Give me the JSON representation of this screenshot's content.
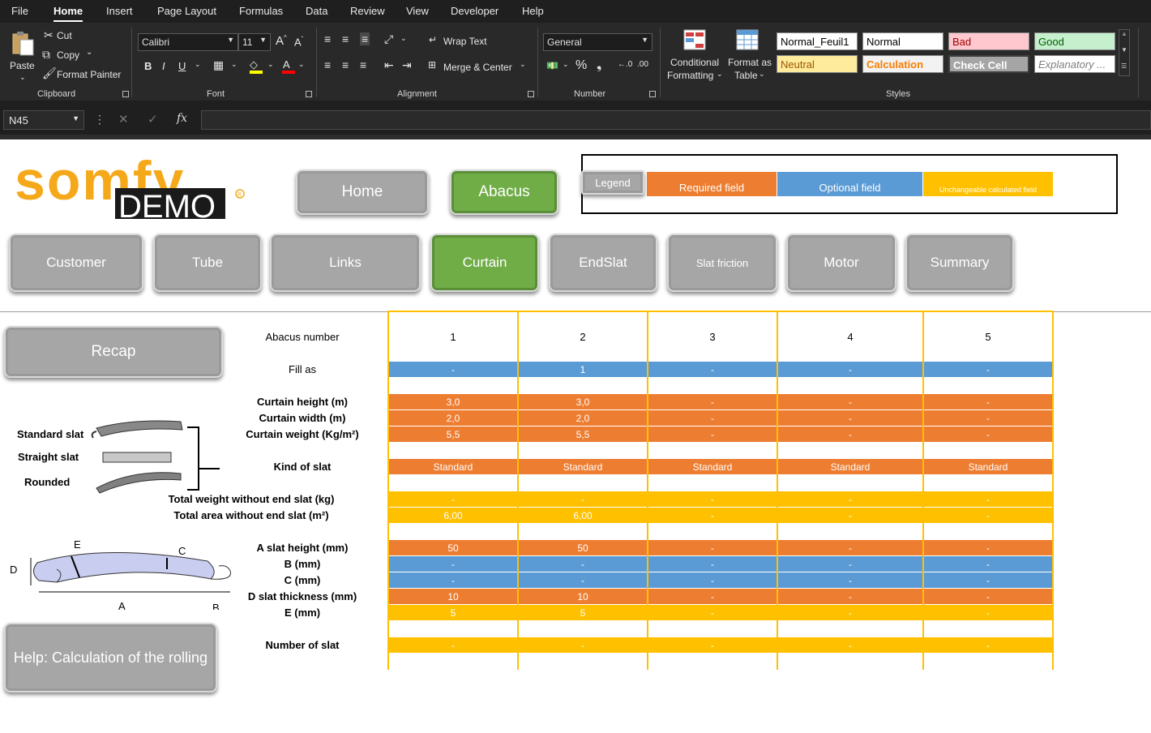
{
  "menu": [
    "File",
    "Home",
    "Insert",
    "Page Layout",
    "Formulas",
    "Data",
    "Review",
    "View",
    "Developer",
    "Help"
  ],
  "clipboard": {
    "paste": "Paste",
    "cut": "Cut",
    "copy": "Copy",
    "format_painter": "Format Painter",
    "group": "Clipboard"
  },
  "font": {
    "name": "Calibri",
    "size": "11",
    "group": "Font",
    "bold": "B",
    "italic": "I",
    "underline": "U"
  },
  "alignment": {
    "wrap_text": "Wrap Text",
    "merge_center": "Merge & Center",
    "group": "Alignment"
  },
  "number": {
    "format": "General",
    "group": "Number"
  },
  "styles": {
    "conditional_formatting": [
      "Conditional",
      "Formatting"
    ],
    "format_as_table": [
      "Format as",
      "Table"
    ],
    "group": "Styles",
    "cells": [
      {
        "label": "Normal_Feuil1",
        "bg": "#ffffff",
        "fg": "#000000"
      },
      {
        "label": "Normal",
        "bg": "#ffffff",
        "fg": "#000000"
      },
      {
        "label": "Bad",
        "bg": "#ffc7ce",
        "fg": "#9c0006"
      },
      {
        "label": "Good",
        "bg": "#c6efce",
        "fg": "#006100"
      },
      {
        "label": "Neutral",
        "bg": "#ffeb9c",
        "fg": "#9c5700"
      },
      {
        "label": "Calculation",
        "bg": "#f2f2f2",
        "fg": "#fa7d00"
      },
      {
        "label": "Check Cell",
        "bg": "#a5a5a5",
        "fg": "#ffffff"
      },
      {
        "label": "Explanatory ...",
        "bg": "#ffffff",
        "fg": "#7f7f7f"
      }
    ]
  },
  "formula_bar": {
    "name_box": "N45",
    "formula": ""
  },
  "logo": {
    "brand": "somfy",
    "sub": "DEMO"
  },
  "nav": {
    "home": "Home",
    "abacus": "Abacus"
  },
  "legend": {
    "title": "Legend",
    "required": "Required field",
    "optional": "Optional field",
    "calculated": "Unchangeable calculated field",
    "colors": {
      "required": "#ed7d31",
      "optional": "#5b9bd5",
      "calculated": "#ffc000"
    }
  },
  "tabs": [
    "Customer",
    "Tube",
    "Links",
    "Curtain",
    "EndSlat",
    "Slat friction",
    "Motor",
    "Summary"
  ],
  "active_tab": "Curtain",
  "side": {
    "recap": "Recap",
    "help": "Help: Calculation of the rolling",
    "slat_types": [
      "Standard slat",
      "Straight slat",
      "Rounded"
    ],
    "diagram_labels": {
      "A": "A",
      "B": "B",
      "C": "C",
      "D": "D",
      "E": "E"
    }
  },
  "table": {
    "row_labels": {
      "abacus_number": "Abacus number",
      "fill_as": "Fill as",
      "curtain_height": "Curtain height (m)",
      "curtain_width": "Curtain width (m)",
      "curtain_weight": "Curtain weight (Kg/m²)",
      "kind_of_slat": "Kind of slat",
      "total_weight": "Total weight without end slat (kg)",
      "total_area": "Total area without end slat (m²)",
      "a_slat_height": "A slat height (mm)",
      "b": "B (mm)",
      "c": "C (mm)",
      "d_slat_thickness": "D slat thickness (mm)",
      "e": "E (mm)",
      "number_of_slat": "Number of slat"
    },
    "columns": [
      {
        "abacus_number": "1",
        "fill_as": "-",
        "curtain_height": "3,0",
        "curtain_width": "2,0",
        "curtain_weight": "5,5",
        "kind_of_slat": "Standard",
        "total_weight": "-",
        "total_area": "6,00",
        "a_slat_height": "50",
        "b": "-",
        "c": "-",
        "d_slat_thickness": "10",
        "e": "5",
        "number_of_slat": "-"
      },
      {
        "abacus_number": "2",
        "fill_as": "1",
        "curtain_height": "3,0",
        "curtain_width": "2,0",
        "curtain_weight": "5,5",
        "kind_of_slat": "Standard",
        "total_weight": "-",
        "total_area": "6,00",
        "a_slat_height": "50",
        "b": "-",
        "c": "-",
        "d_slat_thickness": "10",
        "e": "5",
        "number_of_slat": "-"
      },
      {
        "abacus_number": "3",
        "fill_as": "-",
        "curtain_height": "-",
        "curtain_width": "-",
        "curtain_weight": "-",
        "kind_of_slat": "Standard",
        "total_weight": "-",
        "total_area": "-",
        "a_slat_height": "-",
        "b": "-",
        "c": "-",
        "d_slat_thickness": "-",
        "e": "-",
        "number_of_slat": "-"
      },
      {
        "abacus_number": "4",
        "fill_as": "-",
        "curtain_height": "-",
        "curtain_width": "-",
        "curtain_weight": "-",
        "kind_of_slat": "Standard",
        "total_weight": "-",
        "total_area": "-",
        "a_slat_height": "-",
        "b": "-",
        "c": "-",
        "d_slat_thickness": "-",
        "e": "-",
        "number_of_slat": "-"
      },
      {
        "abacus_number": "5",
        "fill_as": "-",
        "curtain_height": "-",
        "curtain_width": "-",
        "curtain_weight": "-",
        "kind_of_slat": "Standard",
        "total_weight": "-",
        "total_area": "-",
        "a_slat_height": "-",
        "b": "-",
        "c": "-",
        "d_slat_thickness": "-",
        "e": "-",
        "number_of_slat": "-"
      }
    ]
  }
}
